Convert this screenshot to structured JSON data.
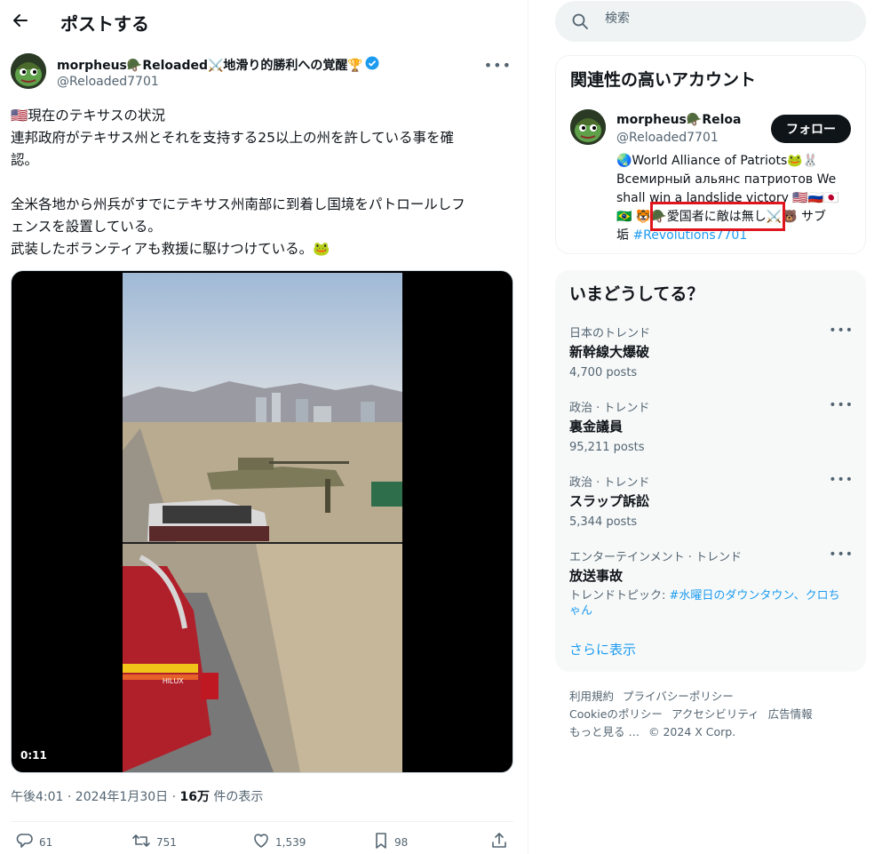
{
  "header": {
    "title": "ポストする"
  },
  "post": {
    "author_name": "morpheus🪖Reloaded⚔️地滑り的勝利への覚醒🏆",
    "author_handle": "@Reloaded7701",
    "text_lines": [
      "🇺🇸現在のテキサスの状況",
      "連邦政府がテキサス州とそれを支持する25以上の州を許している事を確",
      "認。",
      "",
      "全米各地から州兵がすでにテキサス州南部に到着し国境をパトロールしフ",
      "ェンスを設置している。",
      "武装したボランティアも救援に駆けつけている。🐸"
    ],
    "video_time": "0:11",
    "meta_time": "午後4:01 · 2024年1月30日 · ",
    "meta_views": "16万",
    "meta_views_suffix": " 件の表示",
    "replies": "61",
    "reposts": "751",
    "likes": "1,539",
    "bookmarks": "98"
  },
  "search": {
    "placeholder": "検索"
  },
  "related": {
    "title": "関連性の高いアカウント",
    "name": "morpheus🪖Reloaded",
    "handle": "@Reloaded7701",
    "follow_label": "フォロー",
    "bio_lines": [
      "🌏World Alliance of Patriots🐸🐰",
      "Всемирный альянс патриотов We",
      "shall win a landslide victory 🇺🇸🇷🇺🇯🇵",
      "🇧🇷 🐯🪖愛国者に敵は無し⚔️🐻 サブ"
    ],
    "bio_last_prefix": "垢 ",
    "bio_last_link": "#Revolutions7701"
  },
  "trends": {
    "title": "いまどうしてる？",
    "items": [
      {
        "category": "日本のトレンド",
        "name": "新幹線大爆破",
        "count": "4,700 posts"
      },
      {
        "category": "政治 · トレンド",
        "name": "裏金議員",
        "count": "95,211 posts"
      },
      {
        "category": "政治 · トレンド",
        "name": "スラップ訴訟",
        "count": "5,344 posts"
      },
      {
        "category": "エンターテインメント · トレンド",
        "name": "放送事故",
        "topic_prefix": "トレンドトピック: ",
        "topic_link": "#水曜日のダウンタウン、クロちゃん"
      }
    ],
    "show_more": "さらに表示"
  },
  "footer": {
    "links": [
      "利用規約",
      "プライバシーポリシー",
      "Cookieのポリシー",
      "アクセシビリティ",
      "広告情報",
      "もっと見る …"
    ],
    "copyright": "© 2024 X Corp."
  },
  "colors": {
    "accent": "#1d9bf0",
    "highlight_box": "#e0141d",
    "follow_button": "#0f1419"
  }
}
